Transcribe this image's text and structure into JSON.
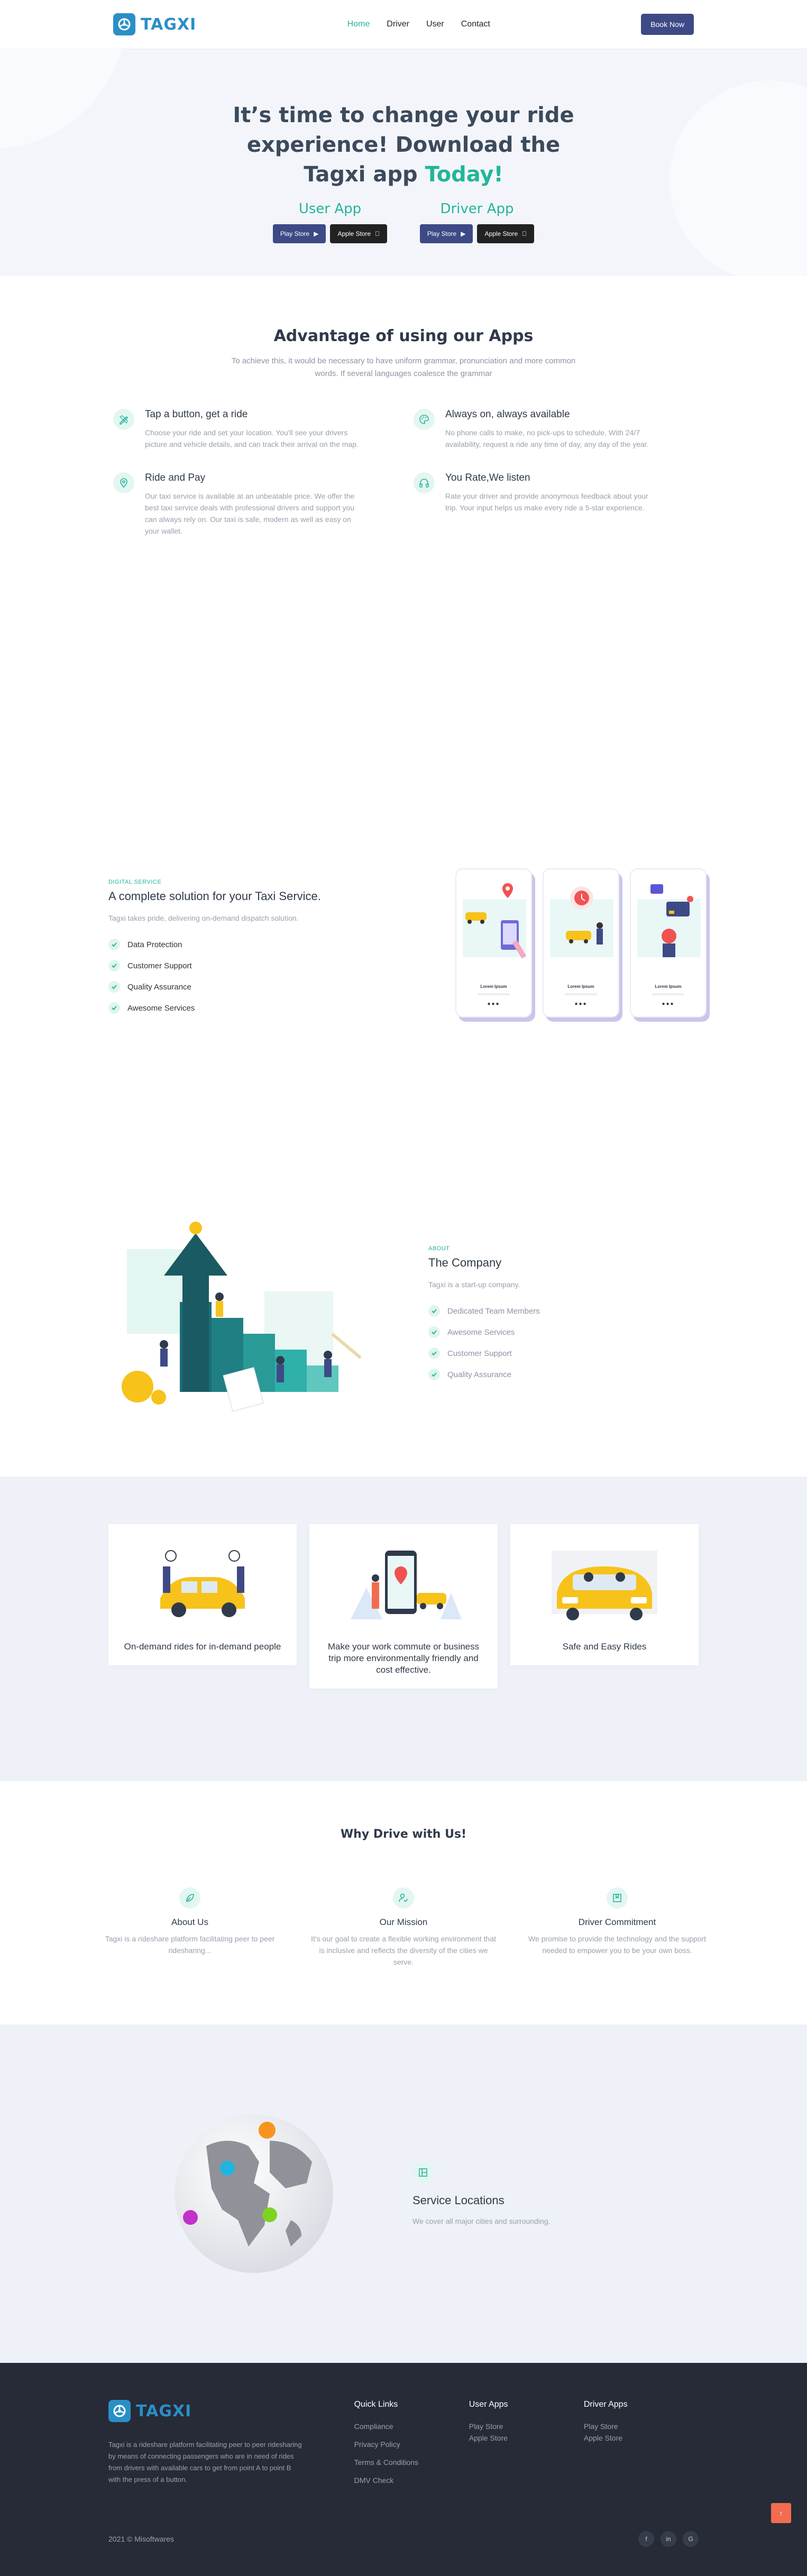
{
  "brand": {
    "name": "TAGXI"
  },
  "nav": {
    "links": [
      "Home",
      "Driver",
      "User",
      "Contact"
    ],
    "cta": "Book Now"
  },
  "hero": {
    "title_main": "It’s time to change your ride experience! Download the Tagxi app",
    "title_accent": "Today!",
    "user_app": "User App",
    "driver_app": "Driver App",
    "play_store": "Play Store",
    "apple_store": "Apple Store"
  },
  "advantages": {
    "title": "Advantage of using our Apps",
    "subtitle": "To achieve this, it would be necessary to have uniform grammar, pronunciation and more common words. If several languages coalesce the grammar",
    "items": [
      {
        "title": "Tap a button, get a ride",
        "text": "Choose your ride and set your location. You'll see your drivers picture and vehicle details, and can track their arrival on the map.",
        "icon": "pencil-ruler-icon"
      },
      {
        "title": "Always on, always available",
        "text": "No phone calls to make, no pick-ups to schedule. With 24/7 availability, request a ride any time of day, any day of the year.",
        "icon": "palette-icon"
      },
      {
        "title": "Ride and Pay",
        "text": "Our taxi service is available at an unbeatable price. We offer the best taxi service deals with professional drivers and support you can always rely on. Our taxi is safe, modern as well as easy on your wallet.",
        "icon": "map-pin-icon"
      },
      {
        "title": "You Rate,We listen",
        "text": "Rate your driver and provide anonymous feedback about your trip. Your input helps us make every ride a 5-star experience.",
        "icon": "headphones-icon"
      }
    ]
  },
  "digital": {
    "eyebrow": "DIGITAL SERVICE",
    "title": "A complete solution for your Taxi Service.",
    "lead": "Tagxi takes pride, delivering on-demand dispatch solution.",
    "features": [
      "Data Protection",
      "Customer Support",
      "Quality Assurance",
      "Awesome Services"
    ],
    "phone_caption": "Lorem Ipsum"
  },
  "company": {
    "eyebrow": "ABOUT",
    "title": "The Company",
    "lead": "Tagxi is a start-up company.",
    "features": [
      "Dedicated Team Members",
      "Awesome Services",
      "Customer Support",
      "Quality Assurance"
    ]
  },
  "cards": [
    {
      "title": "On-demand rides for in-demand people"
    },
    {
      "title": "Make your work commute or business trip more environmentally friendly and cost effective."
    },
    {
      "title": "Safe and Easy Rides"
    }
  ],
  "why": {
    "title": "Why Drive with Us!",
    "items": [
      {
        "title": "About Us",
        "text": "Tagxi is a rideshare platform facilitating peer to peer ridesharing...",
        "icon": "leaf-icon"
      },
      {
        "title": "Our Mission",
        "text": "It's our goal to create a flexible working environment that is inclusive and reflects the diversity of the cities we serve.",
        "icon": "user-check-icon"
      },
      {
        "title": "Driver Commitment",
        "text": "We promise to provide the technology and the support needed to empower you to be your own boss.",
        "icon": "bookmark-icon"
      }
    ]
  },
  "locations": {
    "title": "Service Locations",
    "text": "We cover all major cities and surrounding."
  },
  "footer": {
    "about": "Tagxi is a rideshare platform facilitating peer to peer ridesharing by means of connecting passengers who are in need of rides from drivers with available cars to get from point A to point B with the press of a button.",
    "quick_links_title": "Quick Links",
    "quick_links": [
      "Compliance",
      "Privacy Policy",
      "Terms & Conditions",
      "DMV Check"
    ],
    "user_apps_title": "User Apps",
    "driver_apps_title": "Driver Apps",
    "play_store": "Play Store",
    "apple_store": "Apple Store",
    "copyright": "2021 © Misoftwares",
    "socials": [
      "f",
      "in",
      "G"
    ],
    "to_top": "↑"
  }
}
